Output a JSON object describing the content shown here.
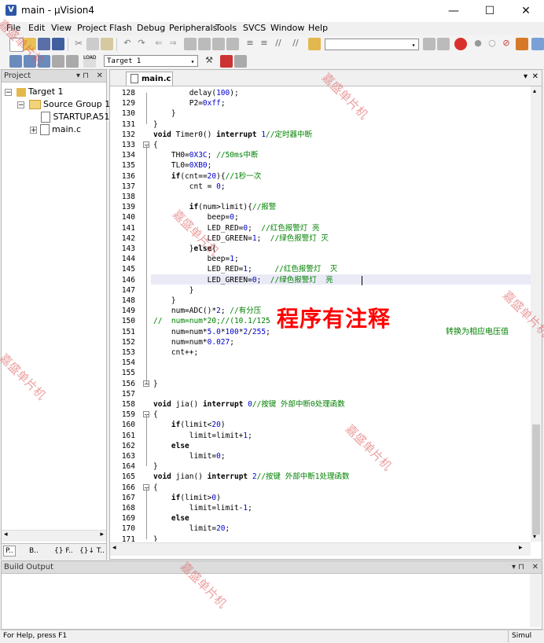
{
  "window": {
    "title": "main - µVision4",
    "minimize": "—",
    "maximize": "☐",
    "close": "✕"
  },
  "menu": [
    "File",
    "Edit",
    "View",
    "Project",
    "Flash",
    "Debug",
    "Peripherals",
    "Tools",
    "SVCS",
    "Window",
    "Help"
  ],
  "toolbar2": {
    "target_select": "Target 1"
  },
  "project_panel": {
    "title": "Project",
    "tree": {
      "target": "Target 1",
      "group": "Source Group 1",
      "files": [
        "STARTUP.A51",
        "main.c"
      ]
    },
    "bottom_tabs": [
      "P..",
      "B..",
      "{} F..",
      "{}↓ T.."
    ]
  },
  "editor": {
    "tab": "main.c",
    "lines": [
      {
        "n": "128",
        "t": "        delay(100);"
      },
      {
        "n": "129",
        "t": "        P2=0xff;"
      },
      {
        "n": "130",
        "t": "    }"
      },
      {
        "n": "131",
        "t": "}"
      },
      {
        "n": "132",
        "t": "void Timer0() interrupt 1//定时器中断"
      },
      {
        "n": "133",
        "t": "{"
      },
      {
        "n": "134",
        "t": "    TH0=0X3C; //50ms中断"
      },
      {
        "n": "135",
        "t": "    TL0=0XB0;"
      },
      {
        "n": "136",
        "t": "    if(cnt==20){//1秒一次"
      },
      {
        "n": "137",
        "t": "        cnt = 0;"
      },
      {
        "n": "138",
        "t": ""
      },
      {
        "n": "139",
        "t": "        if(num>limit){//报警"
      },
      {
        "n": "140",
        "t": "            beep=0;"
      },
      {
        "n": "141",
        "t": "            LED_RED=0;  //红色报警灯 亮"
      },
      {
        "n": "142",
        "t": "            LED_GREEN=1;  //绿色报警灯 灭"
      },
      {
        "n": "143",
        "t": "        }else{"
      },
      {
        "n": "144",
        "t": "            beep=1;"
      },
      {
        "n": "145",
        "t": "            LED_RED=1;     //红色报警灯  灭"
      },
      {
        "n": "146",
        "t": "            LED_GREEN=0;  //绿色报警灯  亮"
      },
      {
        "n": "147",
        "t": "        }"
      },
      {
        "n": "148",
        "t": "    }"
      },
      {
        "n": "149",
        "t": "    num=ADC()*2; //有分压"
      },
      {
        "n": "150",
        "t": "//  num=num*20;//(10.1/125"
      },
      {
        "n": "151",
        "t": "    num=num*5.0*100*2/255;"
      },
      {
        "n": "152",
        "t": "    num=num*0.027;"
      },
      {
        "n": "153",
        "t": "    cnt++;"
      },
      {
        "n": "154",
        "t": ""
      },
      {
        "n": "155",
        "t": ""
      },
      {
        "n": "156",
        "t": "}"
      },
      {
        "n": "157",
        "t": ""
      },
      {
        "n": "158",
        "t": "void jia() interrupt 0//按键 外部中断0处理函数"
      },
      {
        "n": "159",
        "t": "{"
      },
      {
        "n": "160",
        "t": "    if(limit<20)"
      },
      {
        "n": "161",
        "t": "        limit=limit+1;"
      },
      {
        "n": "162",
        "t": "    else"
      },
      {
        "n": "163",
        "t": "        limit=0;"
      },
      {
        "n": "164",
        "t": "}"
      },
      {
        "n": "165",
        "t": "void jian() interrupt 2//按键 外部中断1处理函数"
      },
      {
        "n": "166",
        "t": "{"
      },
      {
        "n": "167",
        "t": "    if(limit>0)"
      },
      {
        "n": "168",
        "t": "        limit=limit-1;"
      },
      {
        "n": "169",
        "t": "    else"
      },
      {
        "n": "170",
        "t": "        limit=20;"
      },
      {
        "n": "171",
        "t": "}"
      }
    ],
    "overflow_comment": "转换为相应电压值"
  },
  "overlay_caption": "程序有注释",
  "watermark": "嘉盛单片机",
  "build_output": {
    "title": "Build Output"
  },
  "status": {
    "help": "For Help, press F1",
    "sim": "Simul"
  }
}
